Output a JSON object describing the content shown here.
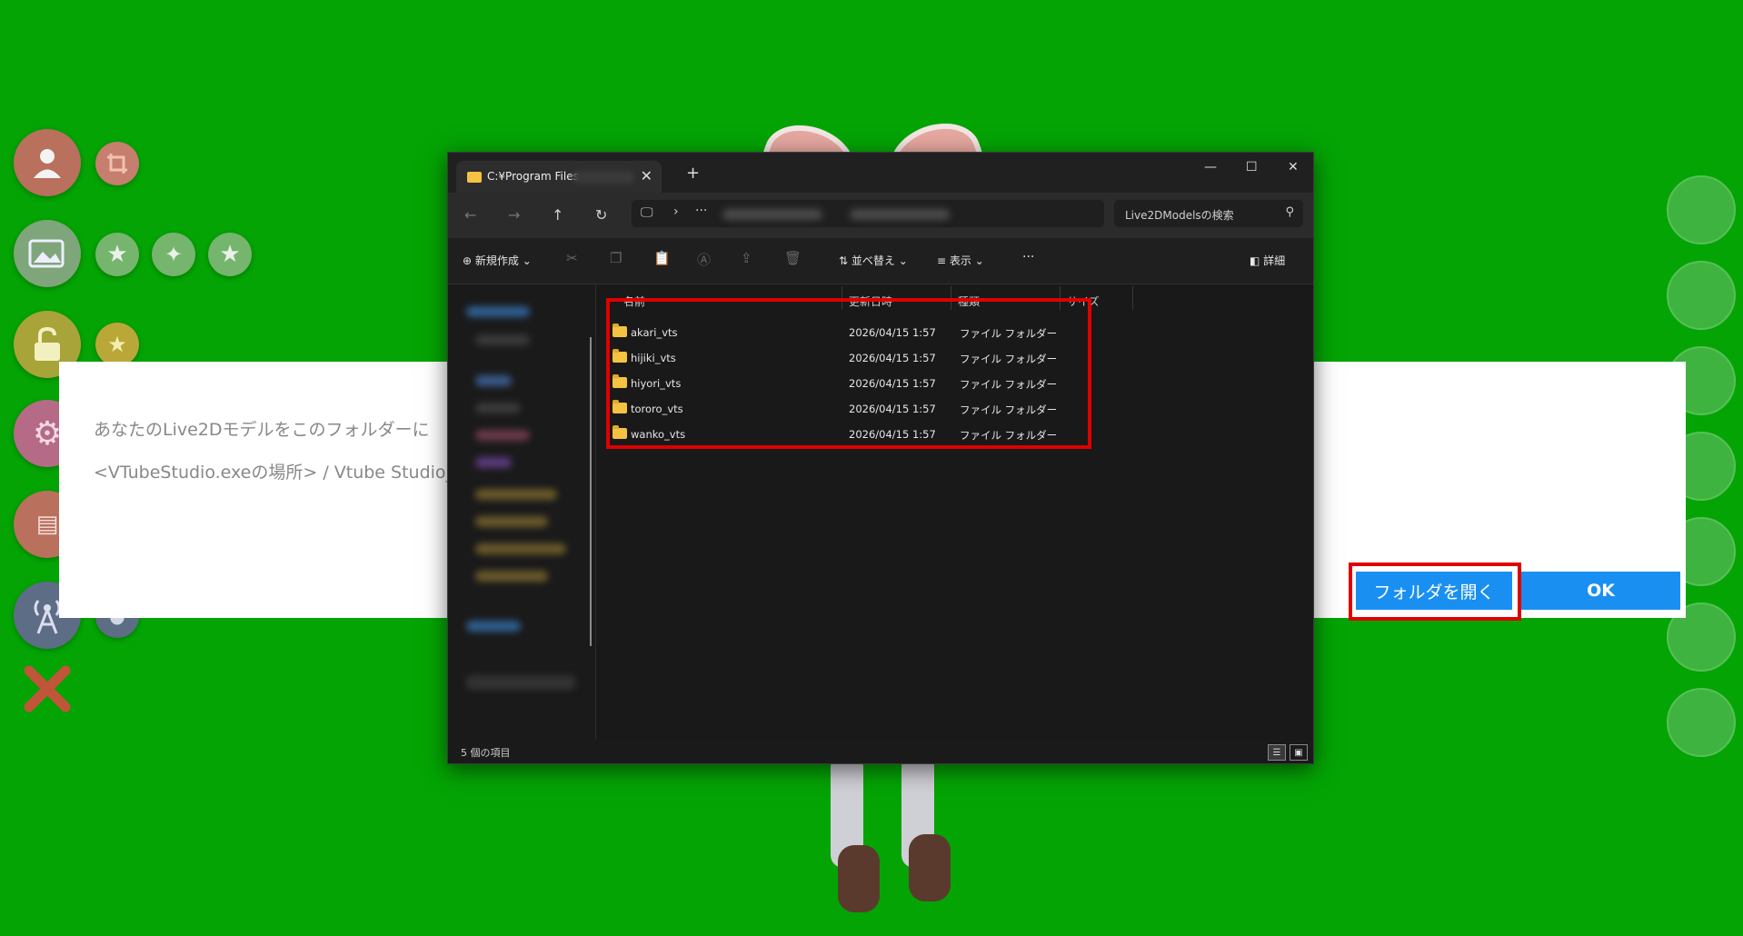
{
  "dialog": {
    "line1": "あなたのLive2Dモデルをこのフォルダーに",
    "line2": "<VTubeStudio.exeの場所> / Vtube Studio_",
    "open_folder_label": "フォルダを開く",
    "ok_label": "OK"
  },
  "explorer": {
    "tab_title": "C:¥Program Files",
    "search_placeholder": "Live2DModelsの検索",
    "toolbar": {
      "new_label": "新規作成",
      "sort_label": "並べ替え",
      "view_label": "表示",
      "more_label": "···",
      "details_label": "詳細"
    },
    "columns": [
      "名前",
      "更新日時",
      "種類",
      "サイズ"
    ],
    "rows": [
      {
        "name": "akari_vts",
        "date": "2026/04/15 1:57",
        "type": "ファイル フォルダー"
      },
      {
        "name": "hijiki_vts",
        "date": "2026/04/15 1:57",
        "type": "ファイル フォルダー"
      },
      {
        "name": "hiyori_vts",
        "date": "2026/04/15 1:57",
        "type": "ファイル フォルダー"
      },
      {
        "name": "tororo_vts",
        "date": "2026/04/15 1:57",
        "type": "ファイル フォルダー"
      },
      {
        "name": "wanko_vts",
        "date": "2026/04/15 1:57",
        "type": "ファイル フォルダー"
      }
    ],
    "status": "5 個の項目"
  },
  "colors": {
    "background": "#04a404",
    "accent": "#1a8ff2",
    "highlight": "#e00000"
  }
}
